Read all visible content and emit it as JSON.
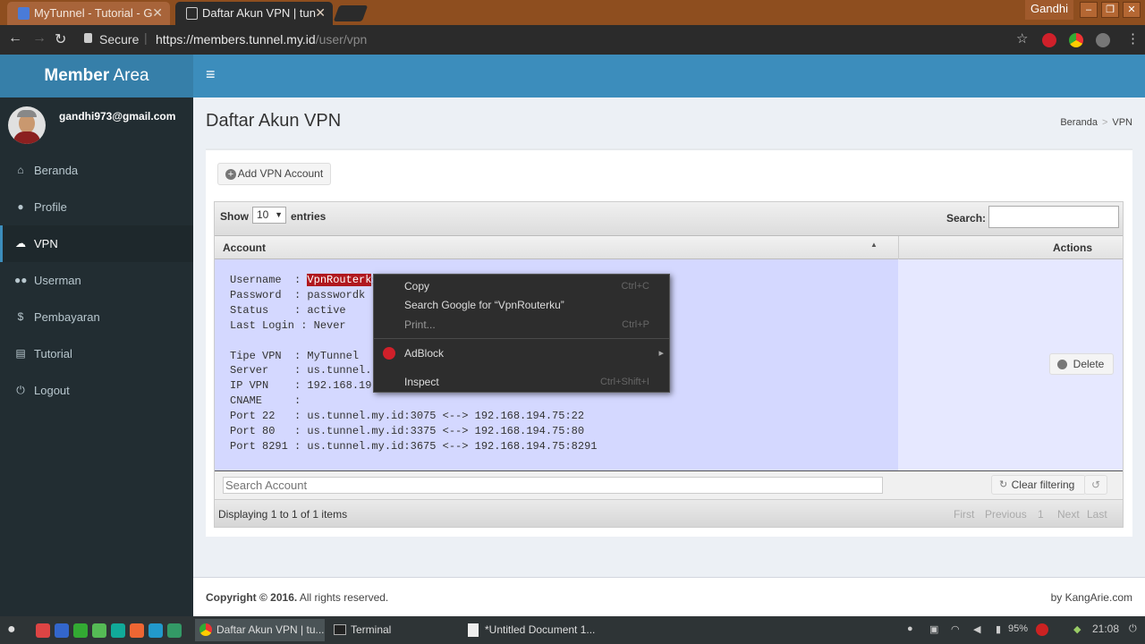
{
  "browser": {
    "tabs": [
      {
        "label": "MyTunnel - Tutorial - G",
        "close": "✕"
      },
      {
        "label": "Daftar Akun VPN | tun",
        "close": "✕"
      }
    ],
    "window_user": "Gandhi",
    "window_buttons": [
      "–",
      "❐",
      "✕"
    ],
    "secure_label": "Secure",
    "url_main": "https://members.tunnel.my.id",
    "url_path": "/user/vpn"
  },
  "app": {
    "logo_bold": "Member",
    "logo_rest": " Area",
    "user_email": "gandhi973@gmail.com",
    "menu": [
      {
        "label": "Beranda",
        "icon": "home-icon"
      },
      {
        "label": "Profile",
        "icon": "user-icon"
      },
      {
        "label": "VPN",
        "icon": "cloud-icon"
      },
      {
        "label": "Userman",
        "icon": "users-icon"
      },
      {
        "label": "Pembayaran",
        "icon": "dollar-icon"
      },
      {
        "label": "Tutorial",
        "icon": "book-icon"
      },
      {
        "label": "Logout",
        "icon": "power-icon"
      }
    ],
    "page_title": "Daftar Akun VPN",
    "breadcrumb": [
      "Beranda",
      "VPN"
    ],
    "add_button": "Add VPN Account",
    "grid": {
      "show_label": "Show",
      "page_size": "10",
      "entries_label": "entries",
      "search_label": "Search:",
      "col_account": "Account",
      "col_actions": "Actions",
      "row": {
        "lines_before": [
          "Username  : ",
          "Password  : passwordk",
          "Status    : active",
          "Last Login : Never",
          "",
          "Tipe VPN  : MyTunnel",
          "Server    : us.tunnel.",
          "IP VPN    : 192.168.19",
          "CNAME     :",
          "Port 22   : us.tunnel.my.id:3075 <--> 192.168.194.75:22",
          "Port 80   : us.tunnel.my.id:3375 <--> 192.168.194.75:80",
          "Port 8291 : us.tunnel.my.id:3675 <--> 192.168.194.75:8291"
        ],
        "username_selected": "VpnRouterk",
        "delete_label": "Delete"
      },
      "filter_placeholder": "Search Account",
      "clear_filter": "Clear filtering",
      "status": "Displaying 1 to 1 of 1 items",
      "pager": [
        "First",
        "Previous",
        "1",
        "Next",
        "Last"
      ]
    },
    "footer_copyright_bold": "Copyright © 2016.",
    "footer_copyright_rest": " All rights reserved.",
    "footer_by": "by KangArie.com"
  },
  "context_menu": {
    "items": [
      {
        "label": "Copy",
        "shortcut": "Ctrl+C"
      },
      {
        "label": "Search Google for “VpnRouterku”",
        "shortcut": ""
      },
      {
        "label": "Print...",
        "shortcut": "Ctrl+P"
      },
      {
        "label": "AdBlock",
        "shortcut": "▸"
      },
      {
        "label": "Inspect",
        "shortcut": "Ctrl+Shift+I"
      }
    ]
  },
  "taskbar": {
    "tasks": [
      "Daftar Akun VPN | tu...",
      "Terminal",
      "*Untitled Document 1..."
    ],
    "battery": "95%",
    "clock": "21:08"
  }
}
